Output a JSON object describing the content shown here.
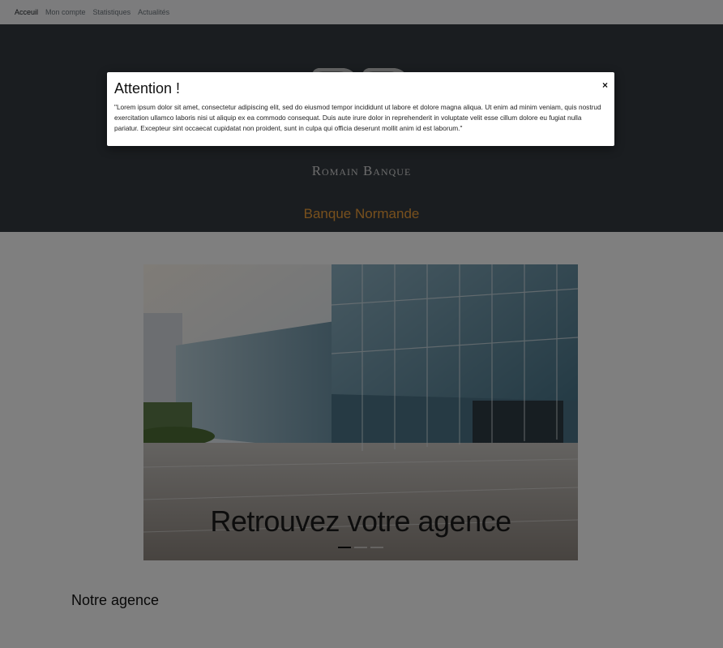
{
  "nav": {
    "items": [
      {
        "label": "Acceuil",
        "active": true
      },
      {
        "label": "Mon compte",
        "active": false
      },
      {
        "label": "Statistiques",
        "active": false
      },
      {
        "label": "Actualités",
        "active": false
      }
    ]
  },
  "hero": {
    "logo_text": "Romain Banque",
    "title": "Banque Normande",
    "accent_color": "#f0a13a"
  },
  "carousel": {
    "caption": "Retrouvez votre agence",
    "slide_count": 3,
    "active_index": 0
  },
  "section": {
    "title": "Notre agence"
  },
  "modal": {
    "title": "Attention !",
    "body": "\"Lorem ipsum dolor sit amet, consectetur adipiscing elit, sed do eiusmod tempor incididunt ut labore et dolore magna aliqua. Ut enim ad minim veniam, quis nostrud exercitation ullamco laboris nisi ut aliquip ex ea commodo consequat. Duis aute irure dolor in reprehenderit in voluptate velit esse cillum dolore eu fugiat nulla pariatur. Excepteur sint occaecat cupidatat non proident, sunt in culpa qui officia deserunt mollit anim id est laborum.\"",
    "close_label": "×"
  }
}
